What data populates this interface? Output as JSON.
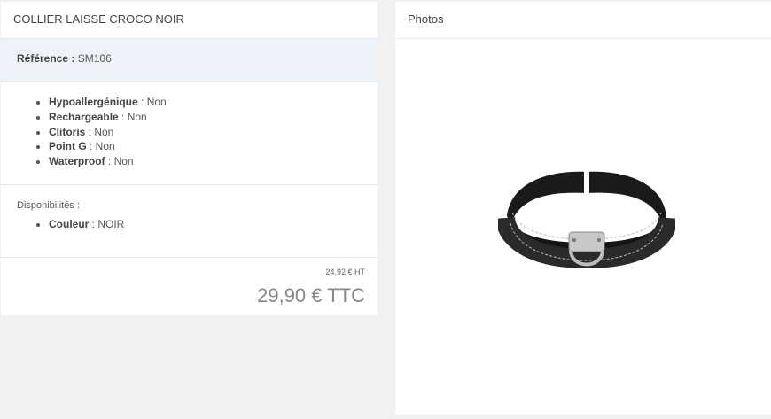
{
  "product": {
    "title": "COLLIER LAISSE CROCO NOIR",
    "reference_label": "Référence :",
    "reference_value": "SM106",
    "features": [
      {
        "label": "Hypoallergénique",
        "value": " : Non"
      },
      {
        "label": "Rechargeable",
        "value": " : Non"
      },
      {
        "label": "Clitoris",
        "value": " : Non"
      },
      {
        "label": "Point G",
        "value": " : Non"
      },
      {
        "label": "Waterproof",
        "value": " : Non"
      }
    ],
    "availability_title": "Disponibilités :",
    "availability": [
      {
        "label": "Couleur",
        "value": " : NOIR"
      }
    ],
    "price_ht": "24,92 € HT",
    "price_ttc": "29,90 € TTC"
  },
  "photos": {
    "title": "Photos",
    "image_icon": "black-leather-collar-image"
  }
}
